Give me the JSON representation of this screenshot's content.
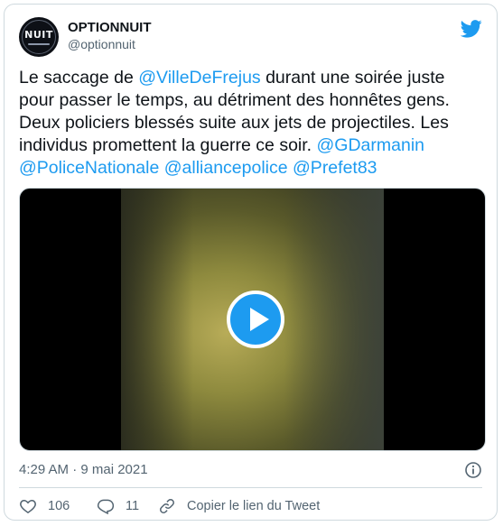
{
  "author": {
    "display_name": "OPTIONNUIT",
    "handle": "@optionnuit",
    "avatar_text": "NUIT"
  },
  "tweet": {
    "text_1": "Le saccage de ",
    "mention_1": "@VilleDeFrejus",
    "text_2": " durant une soirée juste pour passer le temps, au détriment des honnêtes gens. Deux policiers blessés suite aux jets de projectiles. Les individus promettent la guerre ce soir.  ",
    "mention_2": "@GDarmanin",
    "mention_3": "@PoliceNationale",
    "mention_4": "@alliancepolice",
    "mention_5": "@Prefet83"
  },
  "meta": {
    "timestamp": "4:29 AM · 9 mai 2021"
  },
  "actions": {
    "likes": "106",
    "replies": "11",
    "copy_link": "Copier le lien du Tweet"
  },
  "colors": {
    "accent": "#1d9bf0",
    "text": "#0f1419",
    "secondary": "#536471",
    "border": "#cfd9de"
  }
}
